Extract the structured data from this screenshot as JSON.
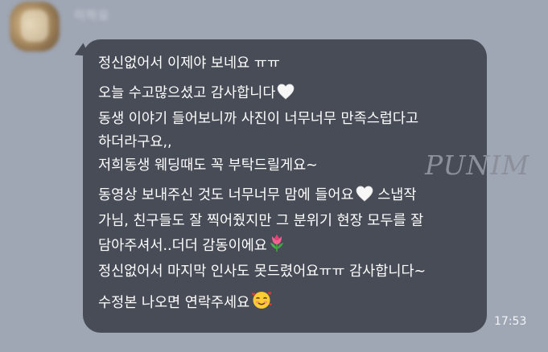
{
  "sender": {
    "name": "이하요"
  },
  "message": {
    "paragraphs": [
      {
        "lines": [
          "정신없어서 이제야 보네요 ㅠㅠ"
        ]
      },
      {
        "lines": [
          "오늘 수고많으셨고 감사합니다",
          "동생 이야기 들어보니까 사진이 너무너무 만족스럽다고",
          "하더라구요,,",
          "저희동생 웨딩때도 꼭 부탁드릴게요~"
        ]
      },
      {
        "lines": [
          "동영상 보내주신 것도 너무너무 맘에 들어요",
          "가님, 친구들도 잘 찍어줬지만 그 분위기 현장 모두를 잘",
          "담아주셔서..더더 감동이에요",
          "정신없어서 마지막 인사도 못드렸어요ㅠㅠ 감사합니다~"
        ]
      },
      {
        "lines": [
          "수정본 나오면 연락주세요"
        ]
      }
    ],
    "inline_after_heart": "스냅작",
    "time": "17:53"
  },
  "watermark": "PUNIM",
  "icons": {
    "heart": "white-heart-icon",
    "tulip": "tulip-icon",
    "smile": "smiling-face-with-hearts-icon"
  },
  "colors": {
    "background": "#9fa6b4",
    "bubble": "#474c56",
    "text": "#ffffff"
  }
}
